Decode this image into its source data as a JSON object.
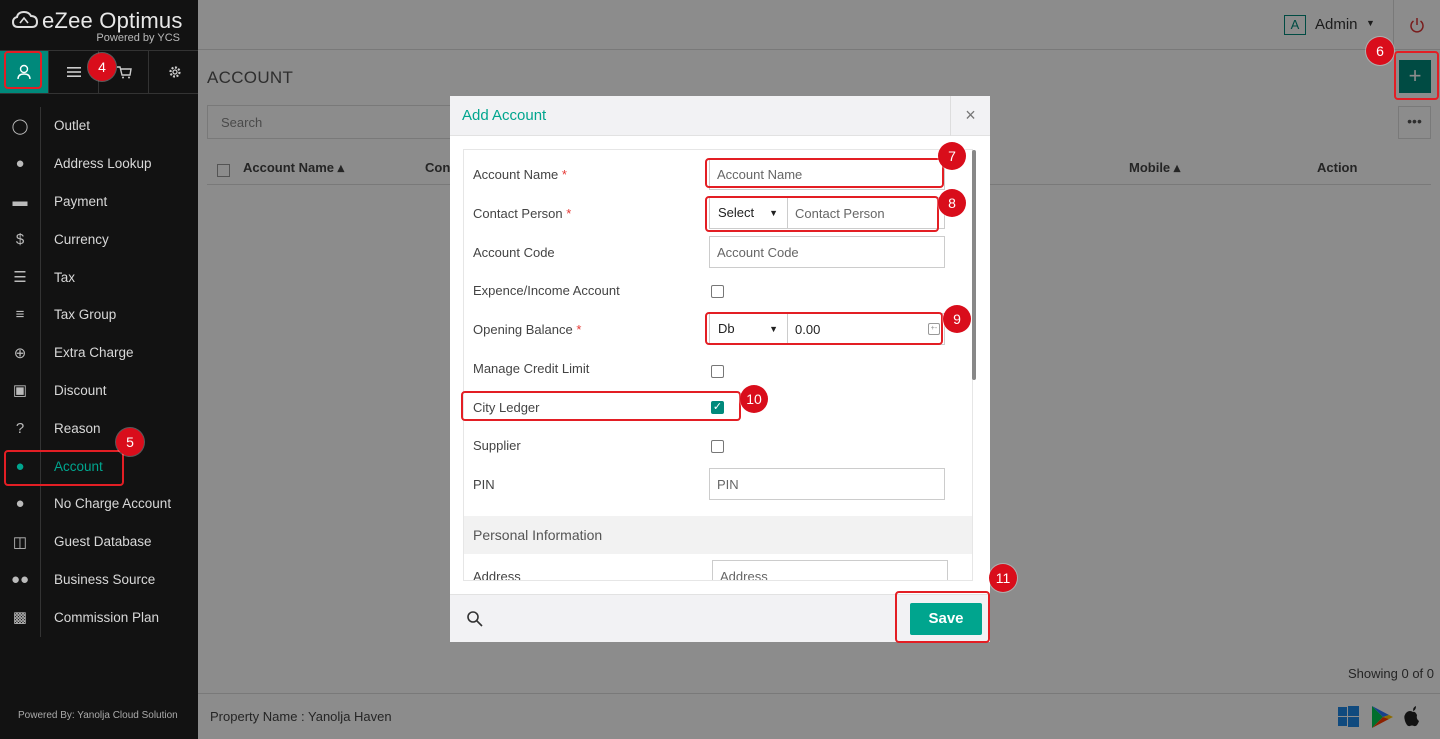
{
  "app": {
    "brand": "eZee Optimus",
    "brand_sub": "Powered by YCS"
  },
  "sidebar": {
    "tabs": [
      {
        "name": "user-icon"
      },
      {
        "name": "menu-icon"
      },
      {
        "name": "cart-icon"
      },
      {
        "name": "gear-icon"
      }
    ],
    "items": [
      {
        "label": "Outlet",
        "icon": "user-icon"
      },
      {
        "label": "Address Lookup",
        "icon": "map-pin-icon"
      },
      {
        "label": "Payment",
        "icon": "credit-card-icon"
      },
      {
        "label": "Currency",
        "icon": "dollar-icon"
      },
      {
        "label": "Tax",
        "icon": "list-icon"
      },
      {
        "label": "Tax Group",
        "icon": "list-ul-icon"
      },
      {
        "label": "Extra Charge",
        "icon": "plus-circle-icon"
      },
      {
        "label": "Discount",
        "icon": "gift-icon"
      },
      {
        "label": "Reason",
        "icon": "question-icon"
      },
      {
        "label": "Account",
        "icon": "user-solid-icon",
        "active": true
      },
      {
        "label": "No Charge Account",
        "icon": "user-solid-icon"
      },
      {
        "label": "Guest Database",
        "icon": "database-icon"
      },
      {
        "label": "Business Source",
        "icon": "users-icon"
      },
      {
        "label": "Commission Plan",
        "icon": "money-icon"
      }
    ],
    "footer": "Powered By: Yanolja Cloud Solution"
  },
  "topbar": {
    "admin_initial": "A",
    "admin_name": "Admin"
  },
  "page": {
    "title": "ACCOUNT",
    "search_placeholder": "Search",
    "columns": {
      "account_name": "Account Name ▴",
      "contact": "Con",
      "mobile": "Mobile ▴",
      "action": "Action"
    },
    "showing": "Showing 0 of 0",
    "property": "Property Name : Yanolja Haven"
  },
  "modal": {
    "title": "Add Account",
    "close": "×",
    "fields": {
      "account_name": {
        "label": "Account Name",
        "placeholder": "Account Name"
      },
      "contact_person": {
        "label": "Contact Person",
        "select": "Select",
        "placeholder": "Contact Person"
      },
      "account_code": {
        "label": "Account Code",
        "placeholder": "Account Code"
      },
      "expence_income": {
        "label": "Expence/Income Account"
      },
      "opening_balance": {
        "label": "Opening Balance",
        "select": "Db",
        "value": "0.00"
      },
      "manage_credit": {
        "label": "Manage Credit Limit"
      },
      "city_ledger": {
        "label": "City Ledger",
        "checked": true
      },
      "supplier": {
        "label": "Supplier"
      },
      "pin": {
        "label": "PIN",
        "placeholder": "PIN"
      },
      "personal_info": "Personal Information",
      "address": {
        "label": "Address",
        "placeholder": "Address"
      }
    },
    "required_mark": "*",
    "save": "Save"
  },
  "annotations": [
    "4",
    "5",
    "6",
    "7",
    "8",
    "9",
    "10",
    "11"
  ],
  "colors": {
    "accent": "#00a58e",
    "highlight": "#e31e24",
    "badge": "#d90d1b"
  }
}
